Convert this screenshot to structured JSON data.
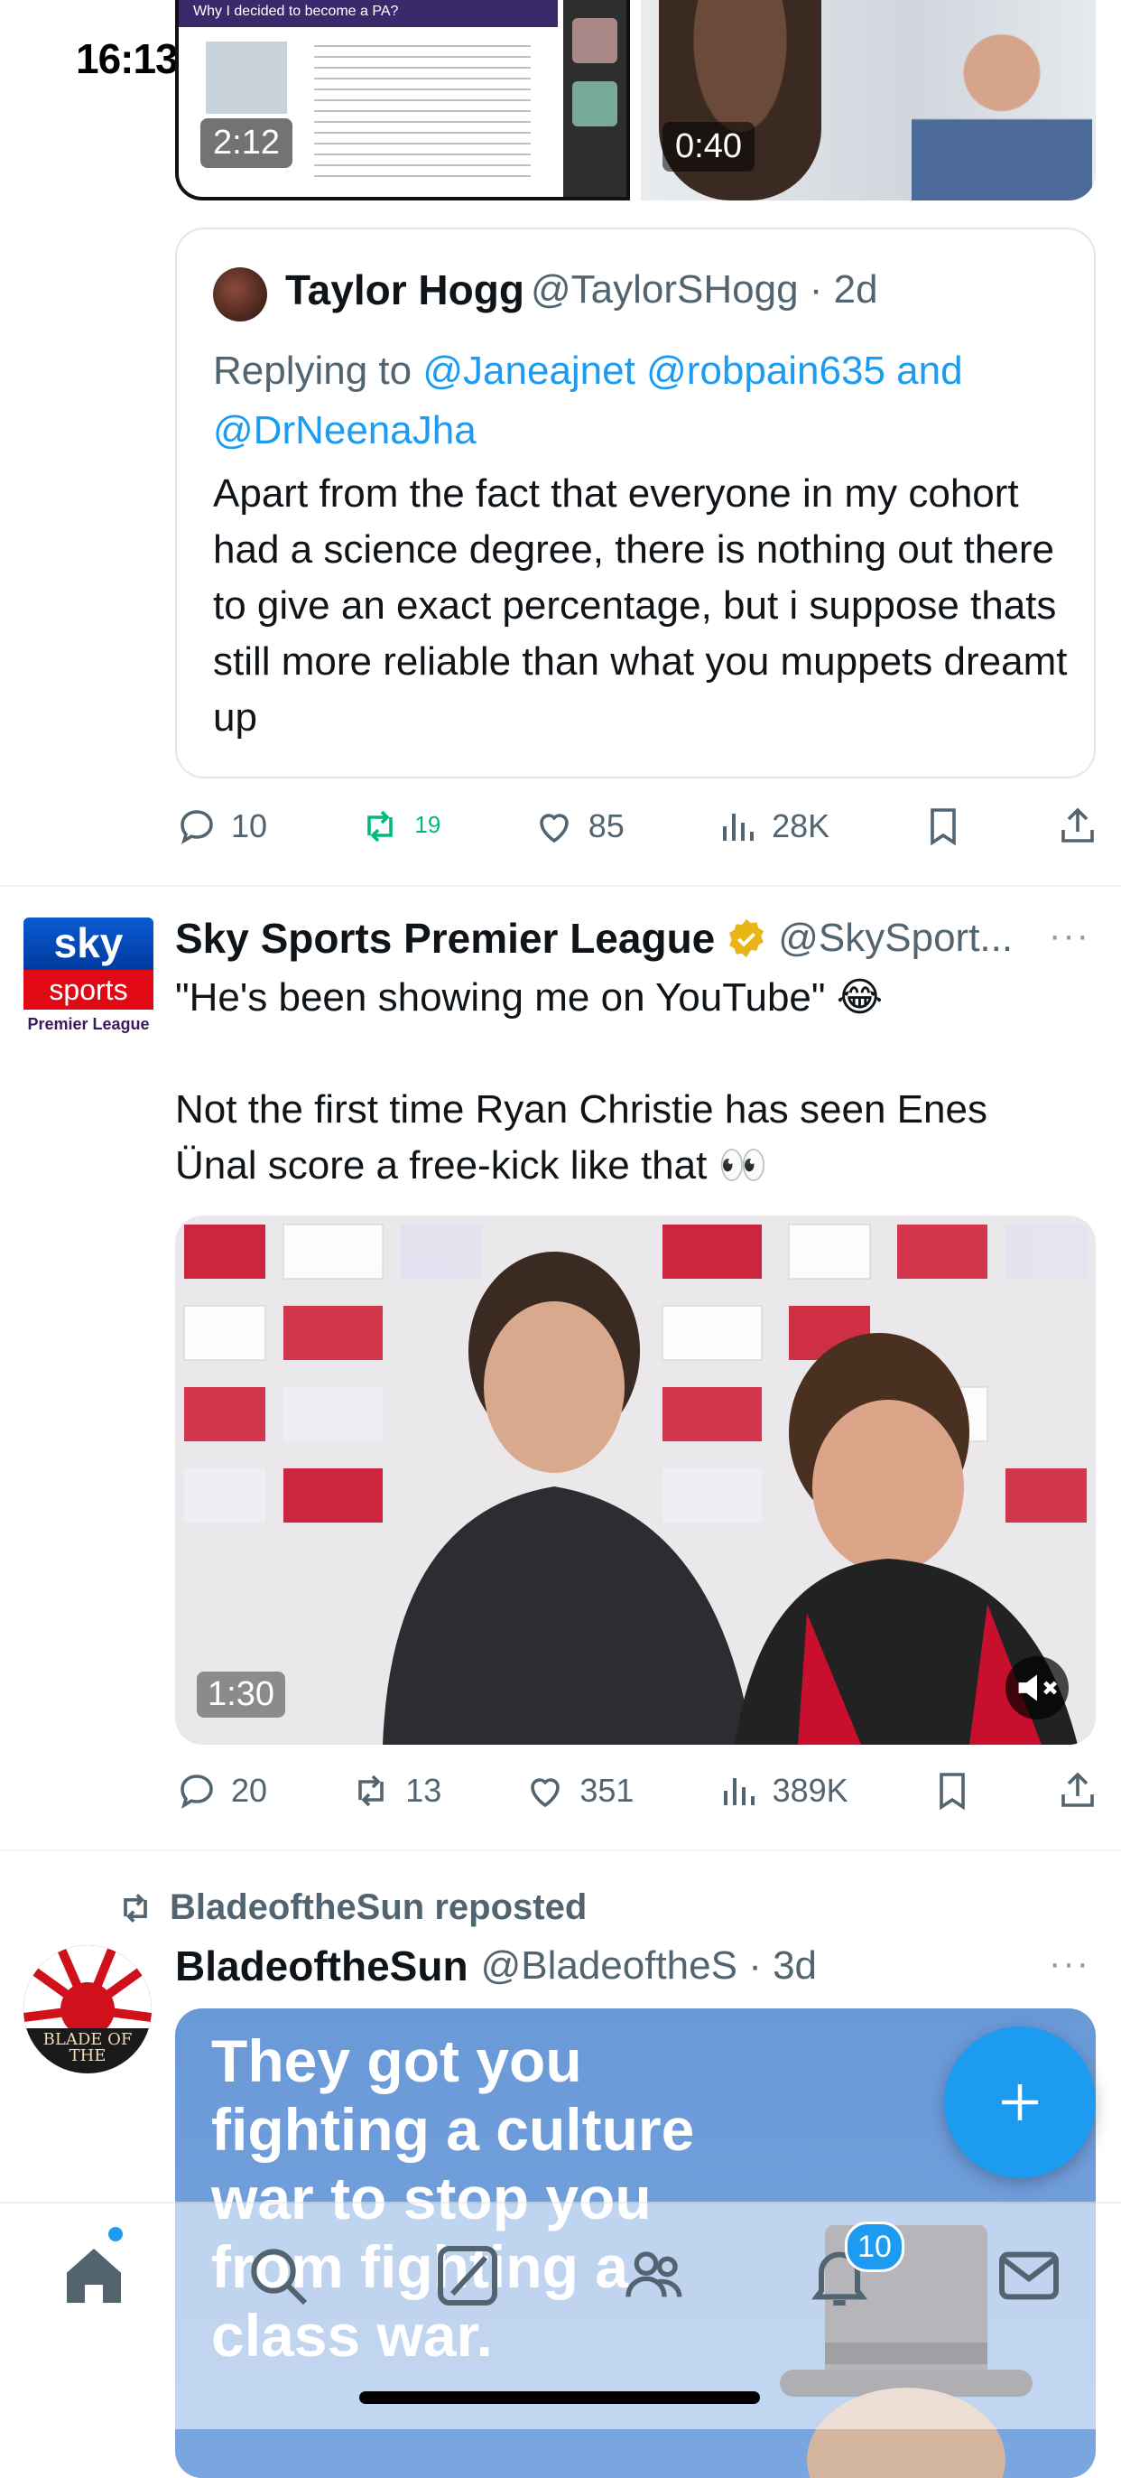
{
  "status_bar": {
    "time": "16:13"
  },
  "quoted_videos": {
    "left": {
      "duration": "2:12",
      "slide_title": "Why I decided to become a PA?"
    },
    "right": {
      "duration": "0:40"
    }
  },
  "quote_card": {
    "author_name": "Taylor Hogg",
    "author_handle": "@TaylorSHogg · 2d",
    "replying_prefix": "Replying to ",
    "replying_users": "@Janeajnet @robpain635 and @DrNeenaJha",
    "body": "Apart from the fact that everyone in my cohort had a science degree, there is nothing out there to give an exact percentage, but i suppose thats still more reliable than what you muppets dreamt up"
  },
  "tweet1_actions": {
    "replies": "10",
    "reposts": "19",
    "likes": "85",
    "views": "28K"
  },
  "tweet2": {
    "logo_top": "sky",
    "logo_bottom": "sports",
    "logo_caption": "Premier League",
    "author_name": "Sky Sports Premier League",
    "author_handle": "@SkySport...",
    "more": "···",
    "line1": "\"He's been showing me on YouTube\" 😂",
    "line2": "Not the first time Ryan Christie has seen Enes Ünal score a free-kick like that 👀",
    "video_duration": "1:30",
    "actions": {
      "replies": "20",
      "reposts": "13",
      "likes": "351",
      "views": "389K"
    }
  },
  "tweet3": {
    "repost_label": "BladeoftheSun reposted",
    "author_name": "BladeoftheSun",
    "author_handle": "@BladeoftheS · 3d",
    "more": "···",
    "avatar_text": "BLADE OF THE",
    "meme_text": "They got you fighting a culture war to stop you from fighting a class war."
  },
  "tab_bar": {
    "notifications_badge": "10"
  },
  "colors": {
    "accent": "#1d9bf0",
    "text": "#0f1419",
    "muted": "#536471",
    "repost_green": "#00ba7c"
  }
}
